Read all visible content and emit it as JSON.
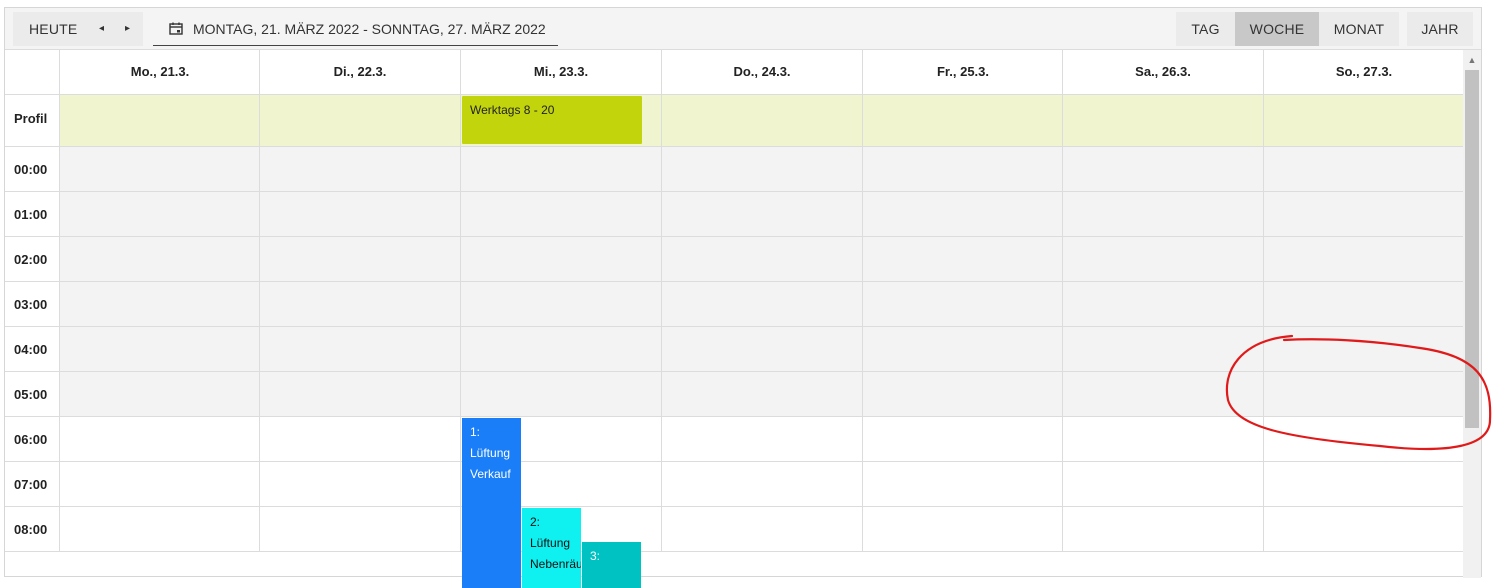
{
  "toolbar": {
    "today_label": "HEUTE",
    "prev_icon": "◂",
    "next_icon": "▸",
    "date_range": "MONTAG, 21. MÄRZ 2022 - SONNTAG, 27. MÄRZ 2022",
    "views": {
      "day": "TAG",
      "week": "WOCHE",
      "month": "MONAT",
      "year": "JAHR"
    },
    "active_view": "week"
  },
  "days": [
    "Mo., 21.3.",
    "Di., 22.3.",
    "Mi., 23.3.",
    "Do., 24.3.",
    "Fr., 25.3.",
    "Sa., 26.3.",
    "So., 27.3."
  ],
  "profile_label": "Profil",
  "hours": [
    "00:00",
    "01:00",
    "02:00",
    "03:00",
    "04:00",
    "05:00",
    "06:00",
    "07:00",
    "08:00"
  ],
  "events": {
    "profile": "Werktags 8 - 20",
    "e1": [
      "1:",
      "Lüftung",
      "Verkauf"
    ],
    "e2": [
      "2:",
      "Lüftung",
      "Nebenräu"
    ],
    "e3": [
      "3:"
    ]
  },
  "colors": {
    "profile_row": "#f1f5cf",
    "off_hours": "#f3f3f3",
    "profile_event": "#c2d40c",
    "event_1": "#1a7ef8",
    "event_2": "#0ff0f0",
    "event_3": "#00c2c2",
    "annotation": "#e01a1a"
  }
}
